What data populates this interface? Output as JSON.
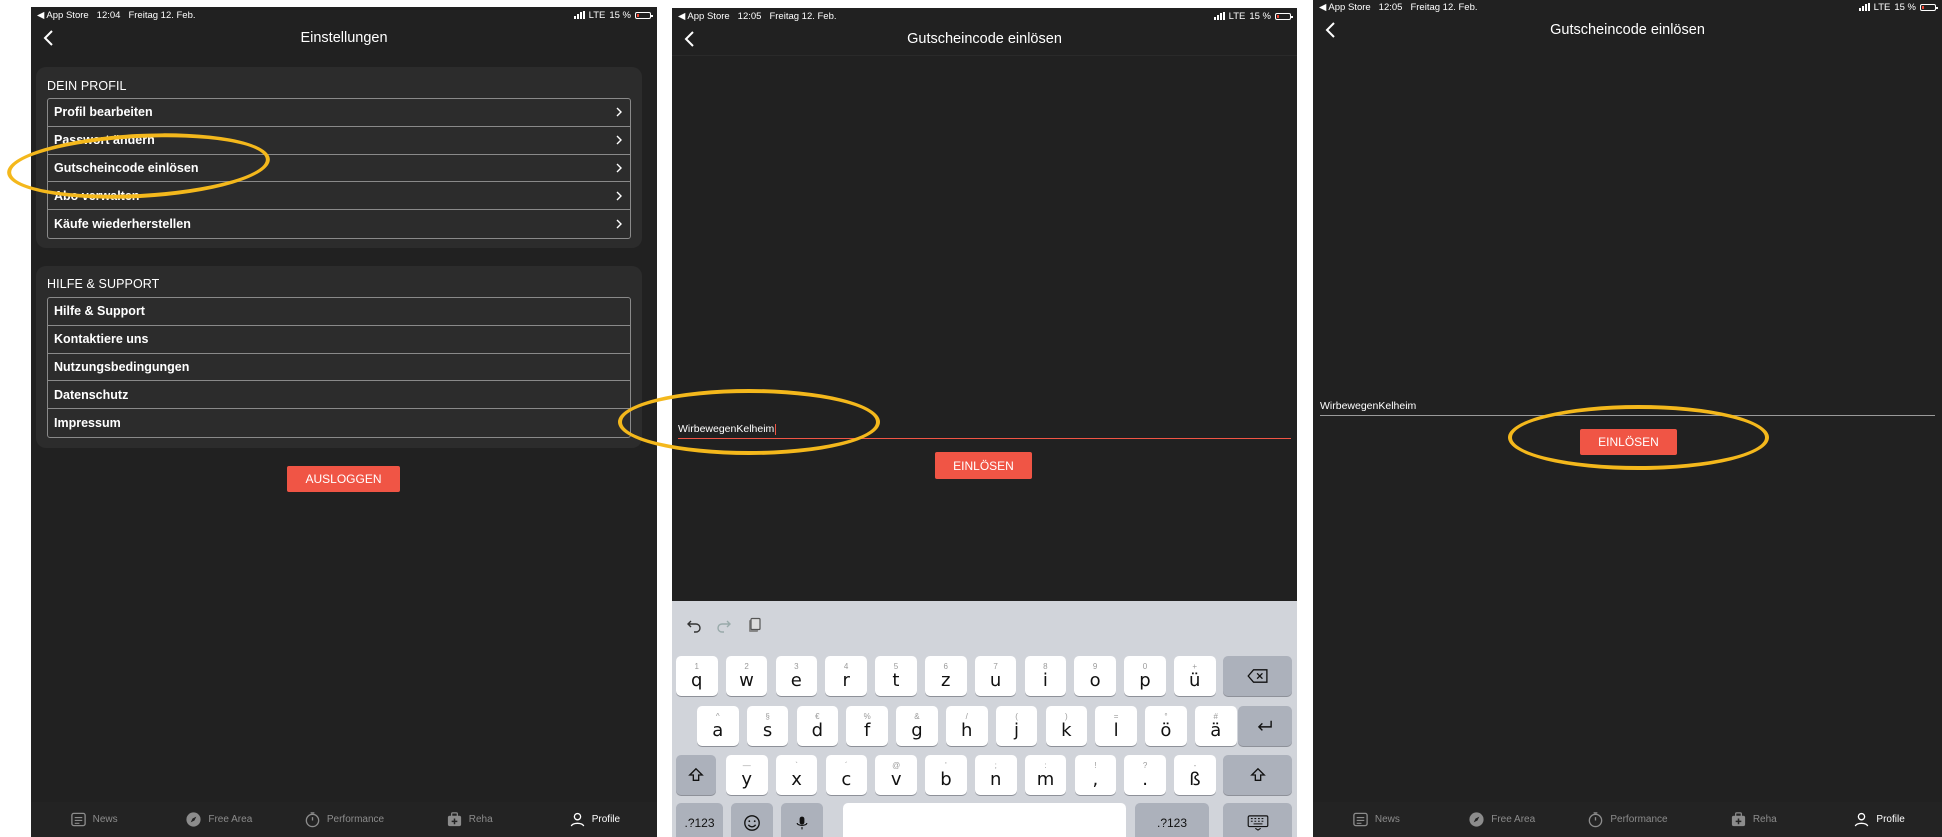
{
  "status": {
    "carrier_back": "◀ App Store",
    "network": "LTE",
    "battery": "15 %",
    "screens": [
      {
        "time": "12:04",
        "date": "Freitag 12. Feb."
      },
      {
        "time": "12:05",
        "date": "Freitag 12. Feb."
      },
      {
        "time": "12:05",
        "date": "Freitag 12. Feb."
      }
    ]
  },
  "settings": {
    "title": "Einstellungen",
    "profile_section": {
      "heading": "DEIN PROFIL",
      "items": [
        "Profil bearbeiten",
        "Passwort ändern",
        "Gutscheincode einlösen",
        "Abo verwalten",
        "Käufe wiederherstellen"
      ]
    },
    "support_section": {
      "heading": "HILFE & SUPPORT",
      "items": [
        "Hilfe & Support",
        "Kontaktiere uns",
        "Nutzungsbedingungen",
        "Datenschutz",
        "Impressum"
      ]
    },
    "logout_label": "AUSLOGGEN"
  },
  "redeem": {
    "title": "Gutscheincode einlösen",
    "code_value": "WirbewegenKelheim",
    "button_label": "EINLÖSEN"
  },
  "tabbar": {
    "tabs": [
      {
        "label": "News",
        "icon": "news-icon"
      },
      {
        "label": "Free Area",
        "icon": "compass-icon"
      },
      {
        "label": "Performance",
        "icon": "stopwatch-icon"
      },
      {
        "label": "Reha",
        "icon": "medkit-icon"
      },
      {
        "label": "Profile",
        "icon": "person-icon"
      }
    ],
    "active": "Profile"
  },
  "keyboard": {
    "row1": [
      [
        "1",
        "q"
      ],
      [
        "2",
        "w"
      ],
      [
        "3",
        "e"
      ],
      [
        "4",
        "r"
      ],
      [
        "5",
        "t"
      ],
      [
        "6",
        "z"
      ],
      [
        "7",
        "u"
      ],
      [
        "8",
        "i"
      ],
      [
        "9",
        "o"
      ],
      [
        "0",
        "p"
      ],
      [
        "+",
        "ü"
      ]
    ],
    "row2": [
      [
        "^",
        "a"
      ],
      [
        "§",
        "s"
      ],
      [
        "€",
        "d"
      ],
      [
        "%",
        "f"
      ],
      [
        "&",
        "g"
      ],
      [
        "/",
        "h"
      ],
      [
        "(",
        "j"
      ],
      [
        ")",
        "k"
      ],
      [
        "=",
        "l"
      ],
      [
        "°",
        "ö"
      ],
      [
        "#",
        "ä"
      ]
    ],
    "row3": [
      [
        "—",
        "y"
      ],
      [
        "`",
        "x"
      ],
      [
        "´",
        "c"
      ],
      [
        "@",
        "v"
      ],
      [
        "'",
        "b"
      ],
      [
        ";",
        "n"
      ],
      [
        ":",
        "m"
      ],
      [
        "!",
        ","
      ],
      [
        "?",
        "."
      ],
      [
        "-",
        "ß"
      ]
    ],
    "numbers_label": ".?123",
    "accent_color": "#f05545",
    "highlight_color": "#f4b81c"
  }
}
